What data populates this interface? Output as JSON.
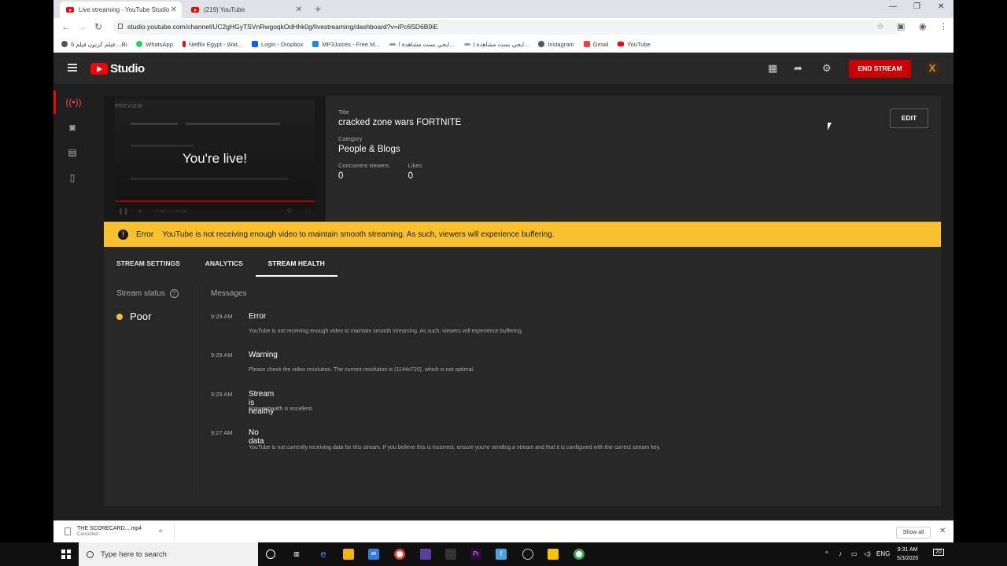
{
  "browser": {
    "tabs": [
      {
        "title": "Live streaming - YouTube Studio",
        "active": true
      },
      {
        "title": "(219) YouTube",
        "active": false
      }
    ],
    "url": "studio.youtube.com/channel/UC2gHGyTSVnRwgoqkOdHhk0g/livestreaming/dashboard?v=iPc6SD6B9iE",
    "bookmarks": [
      "فيلم كرتون فيلم 6 ...Bi",
      "WhatsApp",
      "Netflix Egypt - Wat...",
      "Login - Dropbox",
      "MP3Juices - Free M...",
      "ايجي بست مشاهدة ا...",
      "ايجي بست مشاهدة ا...",
      "Instagram",
      "Gmail",
      "YouTube"
    ]
  },
  "header": {
    "logo_text": "Studio",
    "end_stream_label": "END STREAM",
    "avatar_letter": "X"
  },
  "preview": {
    "label": "PREVIEW",
    "live_text": "You're live!",
    "time": "0:46 / 1:00:44"
  },
  "stream_info": {
    "title_label": "Title",
    "title": "cracked zone wars FORTNITE",
    "category_label": "Category",
    "category": "People & Blogs",
    "viewers_label": "Concurrent viewers",
    "viewers": "0",
    "likes_label": "Likes",
    "likes": "0",
    "edit_label": "EDIT"
  },
  "banner": {
    "title": "Error",
    "message": "YouTube is not receiving enough video to maintain smooth streaming. As such, viewers will experience buffering."
  },
  "tabs": [
    "STREAM SETTINGS",
    "ANALYTICS",
    "STREAM HEALTH"
  ],
  "active_tab": "STREAM HEALTH",
  "stream_status": {
    "label": "Stream status",
    "value": "Poor",
    "color": "#fbc02d"
  },
  "messages": {
    "label": "Messages",
    "items": [
      {
        "time": "9:29 AM",
        "title": "Error",
        "body": "YouTube is not receiving enough video to maintain smooth streaming. As such, viewers will experience buffering."
      },
      {
        "time": "9:29 AM",
        "title": "Warning",
        "body": "Please check the video resolution. The current resolution is (1144x720), which is not optimal."
      },
      {
        "time": "9:29 AM",
        "title": "Stream is healthy",
        "body": "Stream health is excellent."
      },
      {
        "time": "9:27 AM",
        "title": "No data",
        "body": "YouTube is not currently receiving data for this stream. If you believe this is incorrect, ensure you're sending a stream and that it is configured with the correct stream key."
      }
    ]
  },
  "download": {
    "file": "THE SCORECARD....mp4",
    "status": "Cancelled",
    "show_all": "Show all"
  },
  "taskbar": {
    "search_placeholder": "Type here to search",
    "lang": "ENG",
    "time": "9:31 AM",
    "date": "5/3/2020",
    "notif": "20"
  },
  "colors": {
    "accent_red": "#cc0000",
    "banner_yellow": "#fbc02d",
    "bg_dark": "#282828"
  }
}
